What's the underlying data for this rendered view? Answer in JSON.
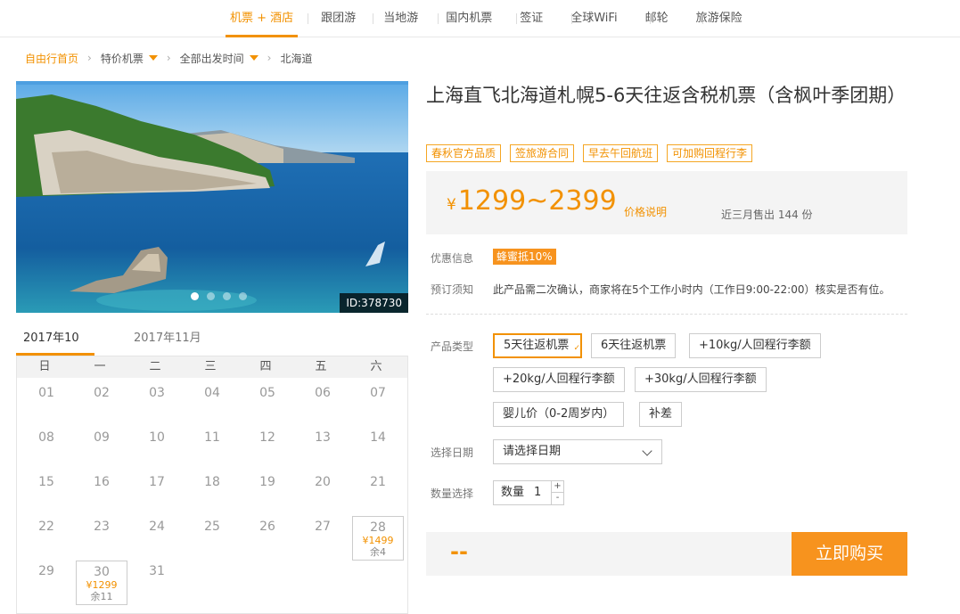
{
  "topnav": {
    "items": [
      "机票 + 酒店",
      "跟团游",
      "当地游",
      "国内机票",
      "签证",
      "全球WiFi",
      "邮轮",
      "旅游保险"
    ]
  },
  "breadcrumb": {
    "home": "自由行首页",
    "level1": "特价机票",
    "level2": "全部出发时间",
    "current": "北海道"
  },
  "product": {
    "id_label": "ID:378730",
    "title": "上海直飞北海道札幌5-6天往返含税机票（含枫叶季团期）",
    "tags": [
      "春秋官方品质",
      "签旅游合同",
      "早去午回航班",
      "可加购回程行李"
    ],
    "price": "1299~2399",
    "currency": "¥",
    "price_explain": "价格说明",
    "sold": "近三月售出 144 份"
  },
  "discount": {
    "label": "优惠信息",
    "badge": "蜂蜜抵10%"
  },
  "notice": {
    "label": "预订须知",
    "text": "此产品需二次确认，商家将在5个工作小时内（工作日9:00-22:00）核实是否有位。"
  },
  "options": {
    "label": "产品类型",
    "items": [
      "5天往返机票",
      "6天往返机票",
      "+10kg/人回程行李额",
      "+20kg/人回程行李额",
      "+30kg/人回程行李额",
      "婴儿价（0-2周岁内）",
      "补差"
    ],
    "selected_index": 0
  },
  "date": {
    "label": "选择日期",
    "placeholder": "请选择日期"
  },
  "quantity": {
    "label": "数量选择",
    "field_label": "数量",
    "value": "1",
    "plus": "+",
    "minus": "-"
  },
  "buy": {
    "total": "--",
    "button": "立即购买"
  },
  "calendar": {
    "tabs": [
      "2017年10月",
      "2017年11月"
    ],
    "weekdays": [
      "日",
      "一",
      "二",
      "三",
      "四",
      "五",
      "六"
    ],
    "days": [
      "01",
      "02",
      "03",
      "04",
      "05",
      "06",
      "07",
      "08",
      "09",
      "10",
      "11",
      "12",
      "13",
      "14",
      "15",
      "16",
      "17",
      "18",
      "19",
      "20",
      "21",
      "22",
      "23",
      "24",
      "25",
      "26",
      "27",
      "28",
      "29",
      "30",
      "31"
    ],
    "day28": {
      "price": "¥1499",
      "remain": "余4"
    },
    "day30": {
      "price": "¥1299",
      "remain": "余11"
    }
  },
  "colors": {
    "accent": "#f29100",
    "button": "#f7931e"
  }
}
